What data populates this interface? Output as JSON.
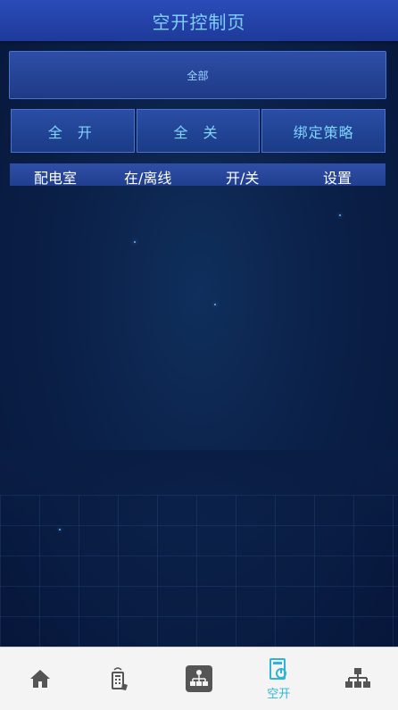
{
  "header": {
    "title": "空开控制页"
  },
  "filter": {
    "label": "全部"
  },
  "actions": [
    {
      "label": "全 开"
    },
    {
      "label": "全 关"
    },
    {
      "label": "绑定策略"
    }
  ],
  "table": {
    "columns": [
      "配电室",
      "在/离线",
      "开/关",
      "设置"
    ]
  },
  "tabbar": {
    "items": [
      {
        "icon": "home-icon",
        "label": ""
      },
      {
        "icon": "remote-device-icon",
        "label": ""
      },
      {
        "icon": "topology-icon",
        "label": ""
      },
      {
        "icon": "switch-icon",
        "label": "空开",
        "active": true
      },
      {
        "icon": "network-icon",
        "label": ""
      }
    ]
  },
  "colors": {
    "header_bg": "#2448b0",
    "accent_text": "#7ed4ff",
    "active_tab": "#2eb4d6",
    "background": "#0b2149"
  }
}
